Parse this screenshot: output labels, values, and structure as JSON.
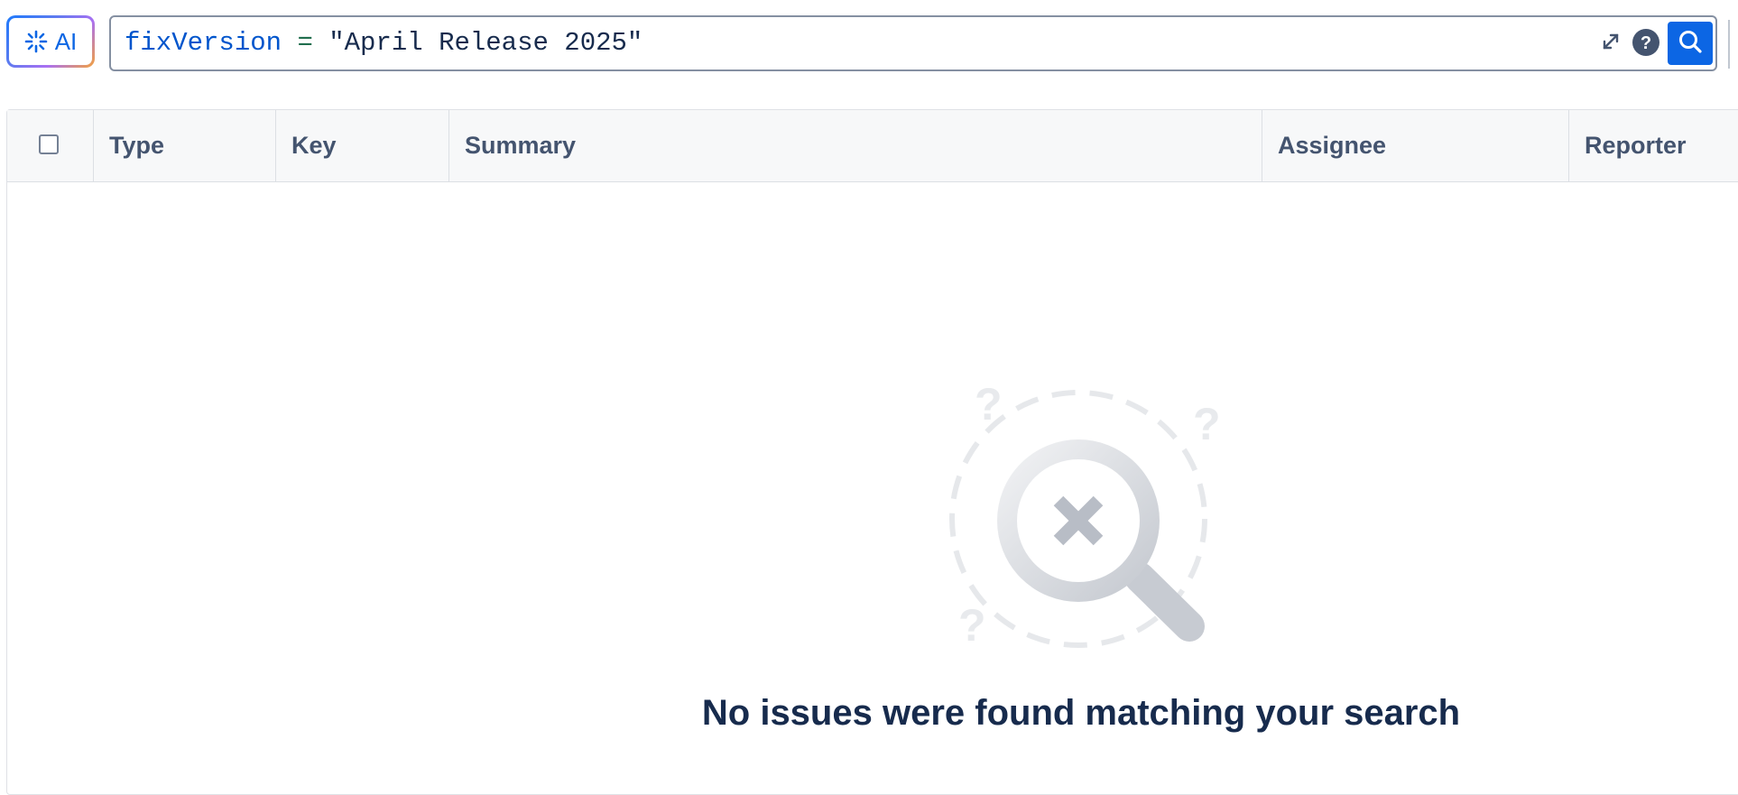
{
  "search": {
    "ai_label": "AI",
    "jql": {
      "field": "fixVersion",
      "operator": "=",
      "value": "\"April Release 2025\""
    }
  },
  "icons": {
    "ai": "sparkle-icon",
    "expand": "expand-icon",
    "help": "help-icon",
    "search": "search-icon",
    "empty_state": "magnifier-no-results-icon"
  },
  "table": {
    "columns": [
      "Type",
      "Key",
      "Summary",
      "Assignee",
      "Reporter"
    ]
  },
  "empty_state": {
    "message": "No issues were found matching your search"
  },
  "colors": {
    "primary": "#0c66e4",
    "jql_field": "#0055cc",
    "jql_operator": "#216e4e",
    "header_bg": "#f7f8f9",
    "header_text": "#44546f"
  }
}
